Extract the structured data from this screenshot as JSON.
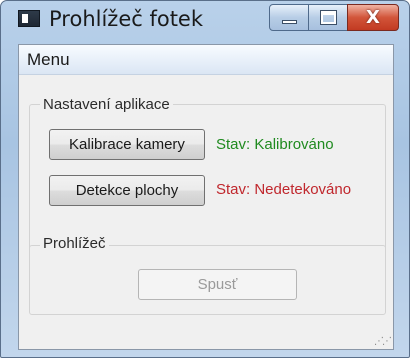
{
  "window": {
    "title": "Prohlížeč fotek",
    "icon": "app-icon",
    "controls": {
      "minimize_icon": "minimize-icon",
      "maximize_icon": "maximize-icon",
      "close_icon": "close-icon",
      "close_glyph": "X"
    }
  },
  "menubar": {
    "items": [
      {
        "label": "Menu"
      }
    ]
  },
  "settings_group": {
    "title": "Nastavení aplikace",
    "calibrate_button": "Kalibrace kamery",
    "calibrate_status": "Stav: Kalibrováno",
    "detect_button": "Detekce plochy",
    "detect_status": "Stav: Nedetekováno"
  },
  "viewer_group": {
    "title": "Prohlížeč",
    "start_button": "Spusť",
    "start_enabled": false
  },
  "colors": {
    "status_ok": "#1f8a1f",
    "status_error": "#c0272d",
    "titlebar": "#b9d1ea",
    "close_button": "#c23a22"
  }
}
